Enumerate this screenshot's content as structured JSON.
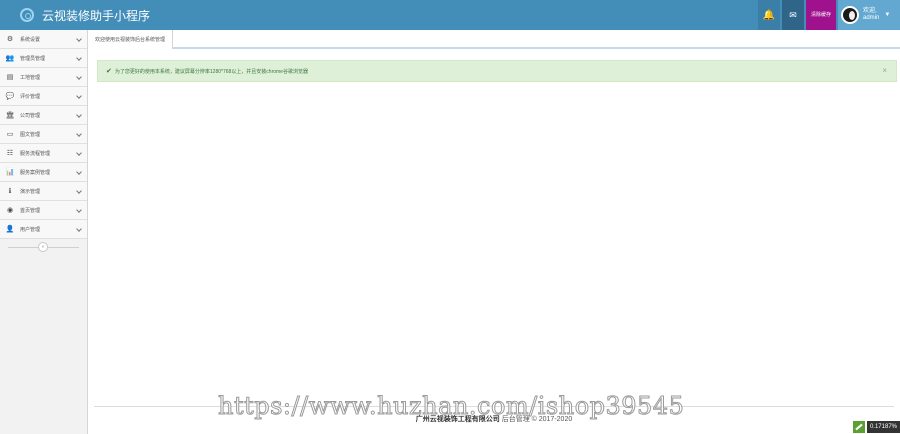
{
  "header": {
    "title": "云视装修助手小程序",
    "logo_icon": "brand-logo-icon",
    "clear_cache_label": "清除缓存",
    "user": {
      "greeting": "欢迎,",
      "name": "admin"
    }
  },
  "sidebar": {
    "items": [
      {
        "icon": "⚙",
        "label": "系统设置"
      },
      {
        "icon": "👥",
        "label": "管理员管理"
      },
      {
        "icon": "▤",
        "label": "工地管理"
      },
      {
        "icon": "💬",
        "label": "评价管理"
      },
      {
        "icon": "🏛",
        "label": "公司管理"
      },
      {
        "icon": "▭",
        "label": "图文管理"
      },
      {
        "icon": "☷",
        "label": "服务流程管理"
      },
      {
        "icon": "📊",
        "label": "服务案例管理"
      },
      {
        "icon": "ℹ",
        "label": "演示管理"
      },
      {
        "icon": "◉",
        "label": "首页管理"
      },
      {
        "icon": "👤",
        "label": "用户管理"
      }
    ]
  },
  "tabs": [
    {
      "label": "欢迎使用云视装饰后台系统管理"
    }
  ],
  "alert": {
    "text": "为了您更好的使用本系统，建议屏幕分辨率1280*768以上，并且安装chrome谷歌浏览器",
    "close": "×"
  },
  "footer": {
    "company": "广州云视装饰工程有限公司",
    "suffix": "后台管理 © 2017-2020"
  },
  "watermark": "https://www.huzhan.com/ishop39545",
  "corner_badge": "0.17187%",
  "colors": {
    "header": "#438eb9",
    "cache_button": "#a0128d",
    "alert_bg": "#dff0d8",
    "alert_text": "#3c763d"
  }
}
